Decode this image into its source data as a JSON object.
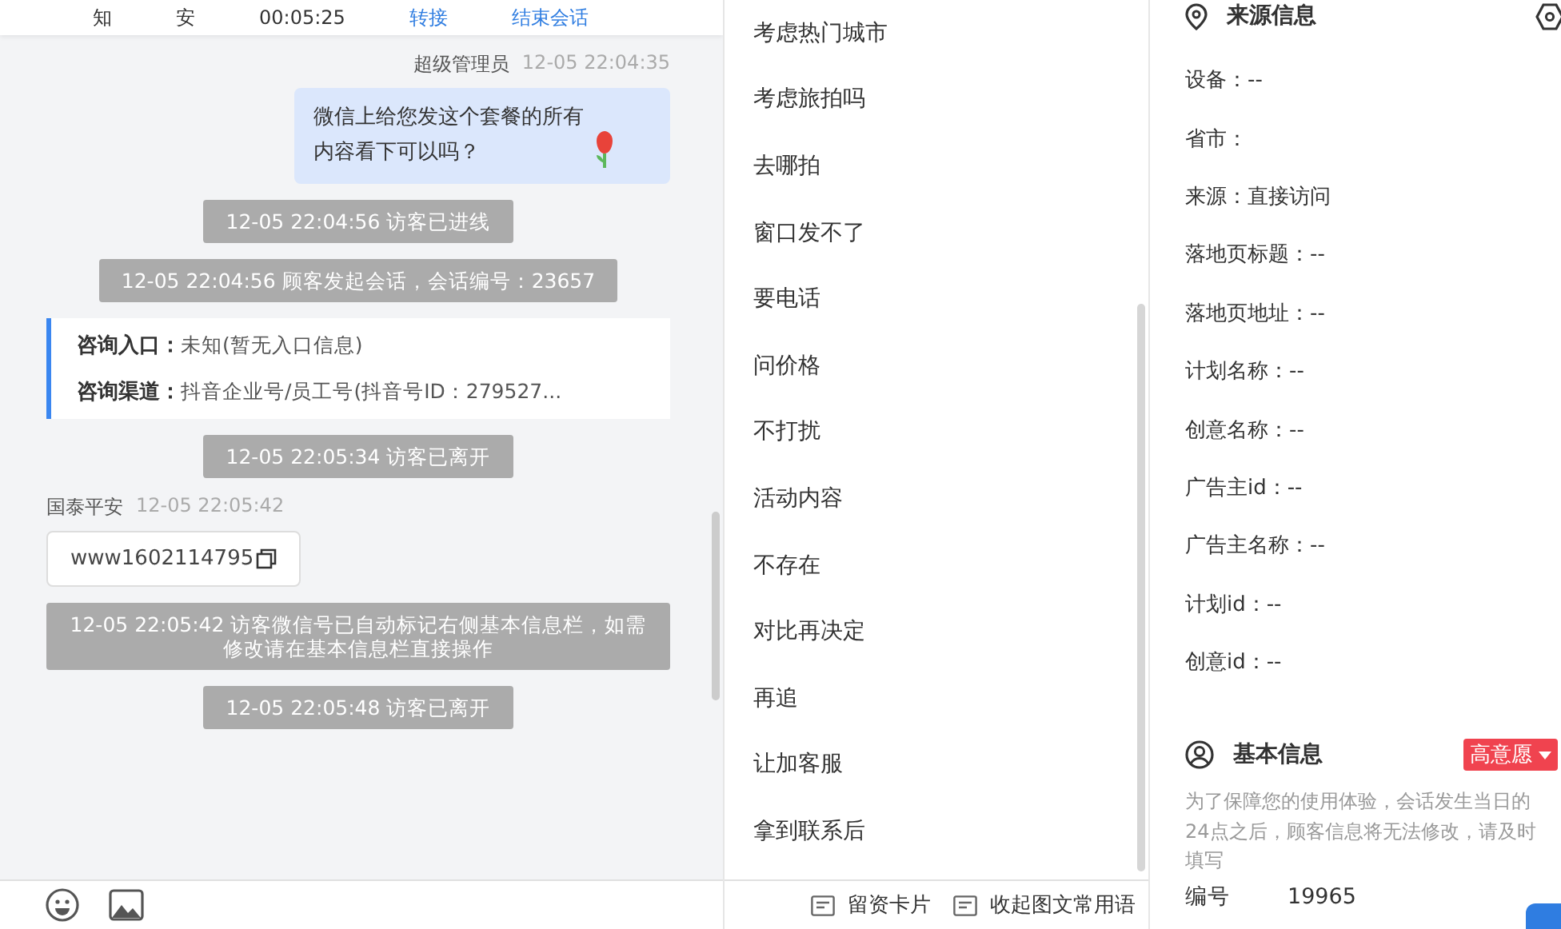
{
  "chat_header": {
    "cells": [
      "知",
      "安",
      "00:05:25"
    ],
    "actions": [
      "转接",
      "结束会话"
    ]
  },
  "messages": [
    {
      "kind": "agent",
      "sender": "超级管理员",
      "time": "12-05 22:04:35",
      "text": "微信上给您发这个套餐的所有内容看下可以吗？",
      "emoji": true
    },
    {
      "kind": "system",
      "text": "12-05 22:04:56 访客已进线"
    },
    {
      "kind": "system",
      "text": "12-05 22:04:56 顾客发起会话，会话编号：23657"
    },
    {
      "kind": "info",
      "rows": [
        {
          "label": "咨询入口：",
          "value": "未知(暂无入口信息)"
        },
        {
          "label": "咨询渠道：",
          "value": "抖音企业号/员工号(抖音号ID：279527..."
        }
      ]
    },
    {
      "kind": "system",
      "text": "12-05 22:05:34 访客已离开"
    },
    {
      "kind": "visitor",
      "sender": "国泰平安",
      "time": "12-05 22:05:42",
      "text": "www1602114795"
    },
    {
      "kind": "system",
      "text": "12-05 22:05:42 访客微信号已自动标记右侧基本信息栏，如需修改请在基本信息栏直接操作"
    },
    {
      "kind": "system",
      "text": "12-05 22:05:48 访客已离开"
    }
  ],
  "quick_replies": [
    "考虑热门城市",
    "考虑旅拍吗",
    "去哪拍",
    "窗口发不了",
    "要电话",
    "问价格",
    "不打扰",
    "活动内容",
    "不存在",
    "对比再决定",
    "再追",
    "让加客服",
    "拿到联系后"
  ],
  "footer_actions": [
    "留资卡片",
    "收起图文常用语"
  ],
  "source_info": {
    "title": "来源信息",
    "fields": [
      "设备：--",
      "省市：",
      "来源：直接访问",
      "落地页标题：--",
      "落地页地址：--",
      "计划名称：--",
      "创意名称：--",
      "广告主id：--",
      "广告主名称：--",
      "计划id：--",
      "创意id：--"
    ]
  },
  "basic_info": {
    "title": "基本信息",
    "tag": "高意愿",
    "notice": "为了保障您的使用体验，会话发生当日的24点之后，顾客信息将无法修改，请及时填写",
    "fields": [
      {
        "label": "编号",
        "value": "19965"
      }
    ]
  }
}
